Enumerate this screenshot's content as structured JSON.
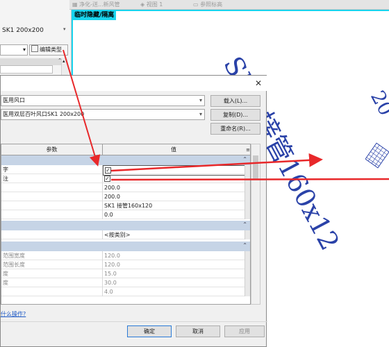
{
  "view_tabs": [
    {
      "label": "净化-送...新风管",
      "active": false
    },
    {
      "label": "视图 1",
      "active": false
    },
    {
      "label": "参照标高",
      "active": false
    }
  ],
  "properties_panel": {
    "type_name": "SK1 200x200",
    "edit_type_label": "编辑类型"
  },
  "canvas": {
    "temp_hide_label": "临时隐藏/隔离",
    "annotation_text": "SK1 接管160x12",
    "annotation_top_digit": "20"
  },
  "dialog": {
    "family_value": "医用风口",
    "type_value": "医用双层百叶风口SK1 200x200",
    "load_button": "载入(L)...",
    "duplicate_button": "复制(D)...",
    "rename_button": "重命名(R)...",
    "col_param": "参数",
    "col_value": "值",
    "rows_group1": [
      {
        "param": "字",
        "value": "",
        "checkbox": true,
        "checked": true
      },
      {
        "param": "注",
        "value": "",
        "checkbox": true,
        "checked": true
      },
      {
        "param": "",
        "value": "200.0"
      },
      {
        "param": "",
        "value": "200.0"
      },
      {
        "param": "",
        "value": "SK1 接管160x120"
      },
      {
        "param": "",
        "value": "0.0"
      }
    ],
    "rows_group2": [
      {
        "param": "",
        "value": "<按类别>"
      }
    ],
    "rows_group3": [
      {
        "param": "范围宽度",
        "value": "120.0",
        "gray": true
      },
      {
        "param": "范围长度",
        "value": "120.0",
        "gray": true
      },
      {
        "param": "度",
        "value": "15.0",
        "gray": true
      },
      {
        "param": "度",
        "value": "30.0",
        "gray": true
      },
      {
        "param": "",
        "value": "4.0",
        "gray": true
      }
    ],
    "help_link": "什么操作?",
    "ok_button": "确定",
    "cancel_button": "取消",
    "apply_button": "应用"
  },
  "colors": {
    "highlight_cyan": "#19d4ee",
    "annotation_blue": "#2a42a8",
    "arrow_red": "#e8282a",
    "group_header": "#c6d4e6"
  }
}
